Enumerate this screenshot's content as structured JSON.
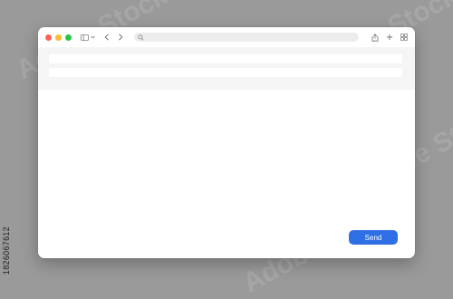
{
  "watermark": {
    "text": "Adobe Stock",
    "image_id": "1826067612"
  },
  "browser": {
    "address": {
      "value": ""
    }
  },
  "form": {
    "fields": [
      {
        "value": ""
      },
      {
        "value": ""
      }
    ],
    "send_label": "Send"
  },
  "colors": {
    "accent": "#2f6fe6",
    "close": "#ff5f57",
    "minimize": "#febc2e",
    "maximize": "#28c840"
  }
}
